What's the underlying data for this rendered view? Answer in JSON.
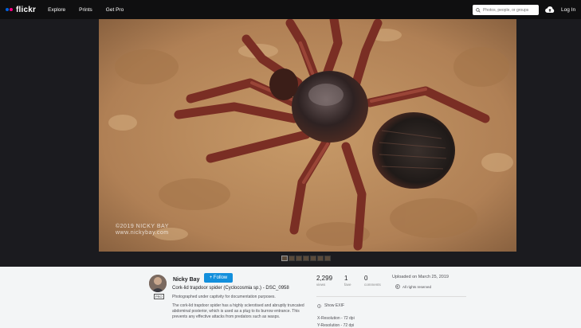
{
  "nav": {
    "logo": "flickr",
    "links": [
      "Explore",
      "Prints",
      "Get Pro"
    ],
    "search_placeholder": "Photos, people, or groups",
    "login": "Log In"
  },
  "photo": {
    "watermark_line1": "©2019 NICKY BAY",
    "watermark_line2": "www.nickybay.com",
    "filmstrip_count": 7
  },
  "owner": {
    "name": "Nicky Bay",
    "follow_label": "+ Follow",
    "pro_badge": "PRO"
  },
  "photo_info": {
    "title": "Cork-lid trapdoor spider (Cyclocosmia sp.) - DSC_0958",
    "caption": "Photographed under captivity for documentation purposes.",
    "description": "The cork-lid trapdoor spider has a highly sclerotised and abruptly truncated abdominal posterior, which is used as a plug to its burrow entrance. This prevents any effective attacks from predators such as wasps."
  },
  "stats": [
    {
      "num": "2,299",
      "label": "views"
    },
    {
      "num": "1",
      "label": "fave"
    },
    {
      "num": "0",
      "label": "comments"
    }
  ],
  "meta": {
    "uploaded": "Uploaded on March 25, 2019",
    "rights": "All rights reserved",
    "show_exif": "Show EXIF",
    "x_resolution": "X-Resolution - 72 dpi",
    "y_resolution": "Y-Resolution - 72 dpi"
  },
  "colors": {
    "nav_bg": "#0f0f10",
    "stage_bg": "#1b1b1f",
    "follow_blue": "#128fdc",
    "logo_blue": "#0063dc",
    "logo_pink": "#ff0084"
  }
}
